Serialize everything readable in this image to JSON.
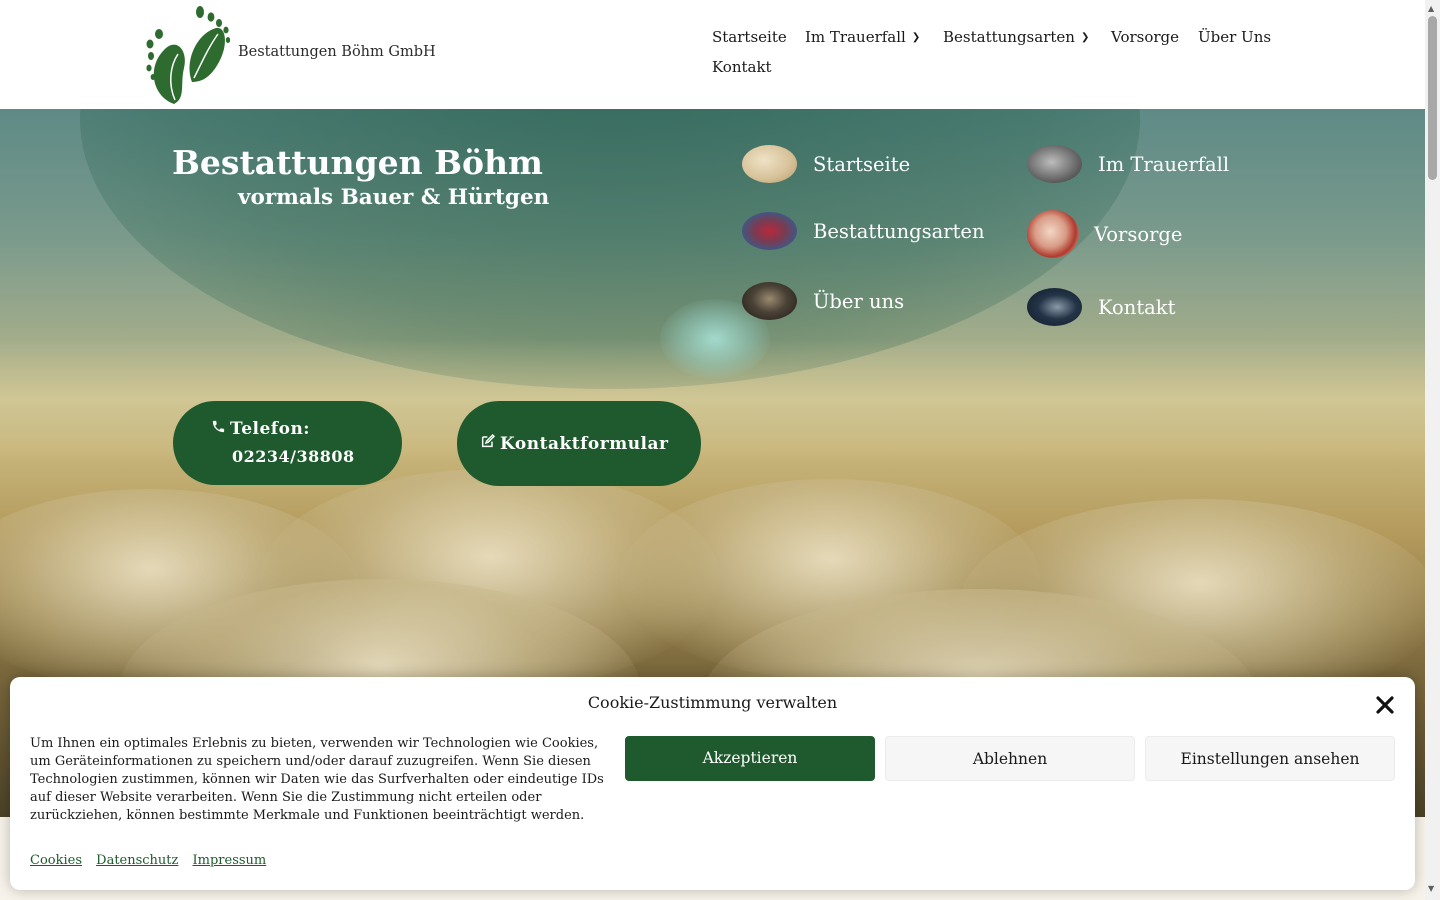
{
  "header": {
    "brand": "Bestattungen Böhm GmbH",
    "nav": [
      {
        "label": "Startseite",
        "has_dropdown": false
      },
      {
        "label": "Im Trauerfall",
        "has_dropdown": true
      },
      {
        "label": "Bestattungsarten",
        "has_dropdown": true
      },
      {
        "label": "Vorsorge",
        "has_dropdown": false
      },
      {
        "label": "Über Uns",
        "has_dropdown": false
      },
      {
        "label": "Kontakt",
        "has_dropdown": false
      }
    ]
  },
  "hero": {
    "title": "Bestattungen Böhm",
    "subtitle": "vormals Bauer & Hürtgen",
    "quick_links": [
      {
        "label": "Startseite",
        "icon": "bread-photo"
      },
      {
        "label": "Im Trauerfall",
        "icon": "mourning-photo"
      },
      {
        "label": "Bestattungsarten",
        "icon": "flowers-photo"
      },
      {
        "label": "Vorsorge",
        "icon": "elderly-couple-photo"
      },
      {
        "label": "Über uns",
        "icon": "interior-photo"
      },
      {
        "label": "Kontakt",
        "icon": "telephone-photo"
      }
    ],
    "phone_button": {
      "line1": "Telefon:",
      "line2": "02234/38808",
      "icon": "phone-icon"
    },
    "form_button": {
      "label": "Kontaktformular",
      "icon": "edit-icon"
    }
  },
  "cookie": {
    "title": "Cookie-Zustimmung verwalten",
    "text": "Um Ihnen ein optimales Erlebnis zu bieten, verwenden wir Technologien wie Cookies, um Geräteinformationen zu speichern und/oder darauf zuzugreifen. Wenn Sie diesen Technologien zustimmen, können wir Daten wie das Surfverhalten oder eindeutige IDs auf dieser Website verarbeiten. Wenn Sie die Zustimmung nicht erteilen oder zurückziehen, können bestimmte Merkmale und Funktionen beeinträchtigt werden.",
    "accept": "Akzeptieren",
    "deny": "Ablehnen",
    "preferences": "Einstellungen ansehen",
    "links": [
      "Cookies",
      "Datenschutz",
      "Impressum"
    ]
  },
  "colors": {
    "brand_green": "#1e5a2d",
    "text": "#1a1a1a"
  }
}
